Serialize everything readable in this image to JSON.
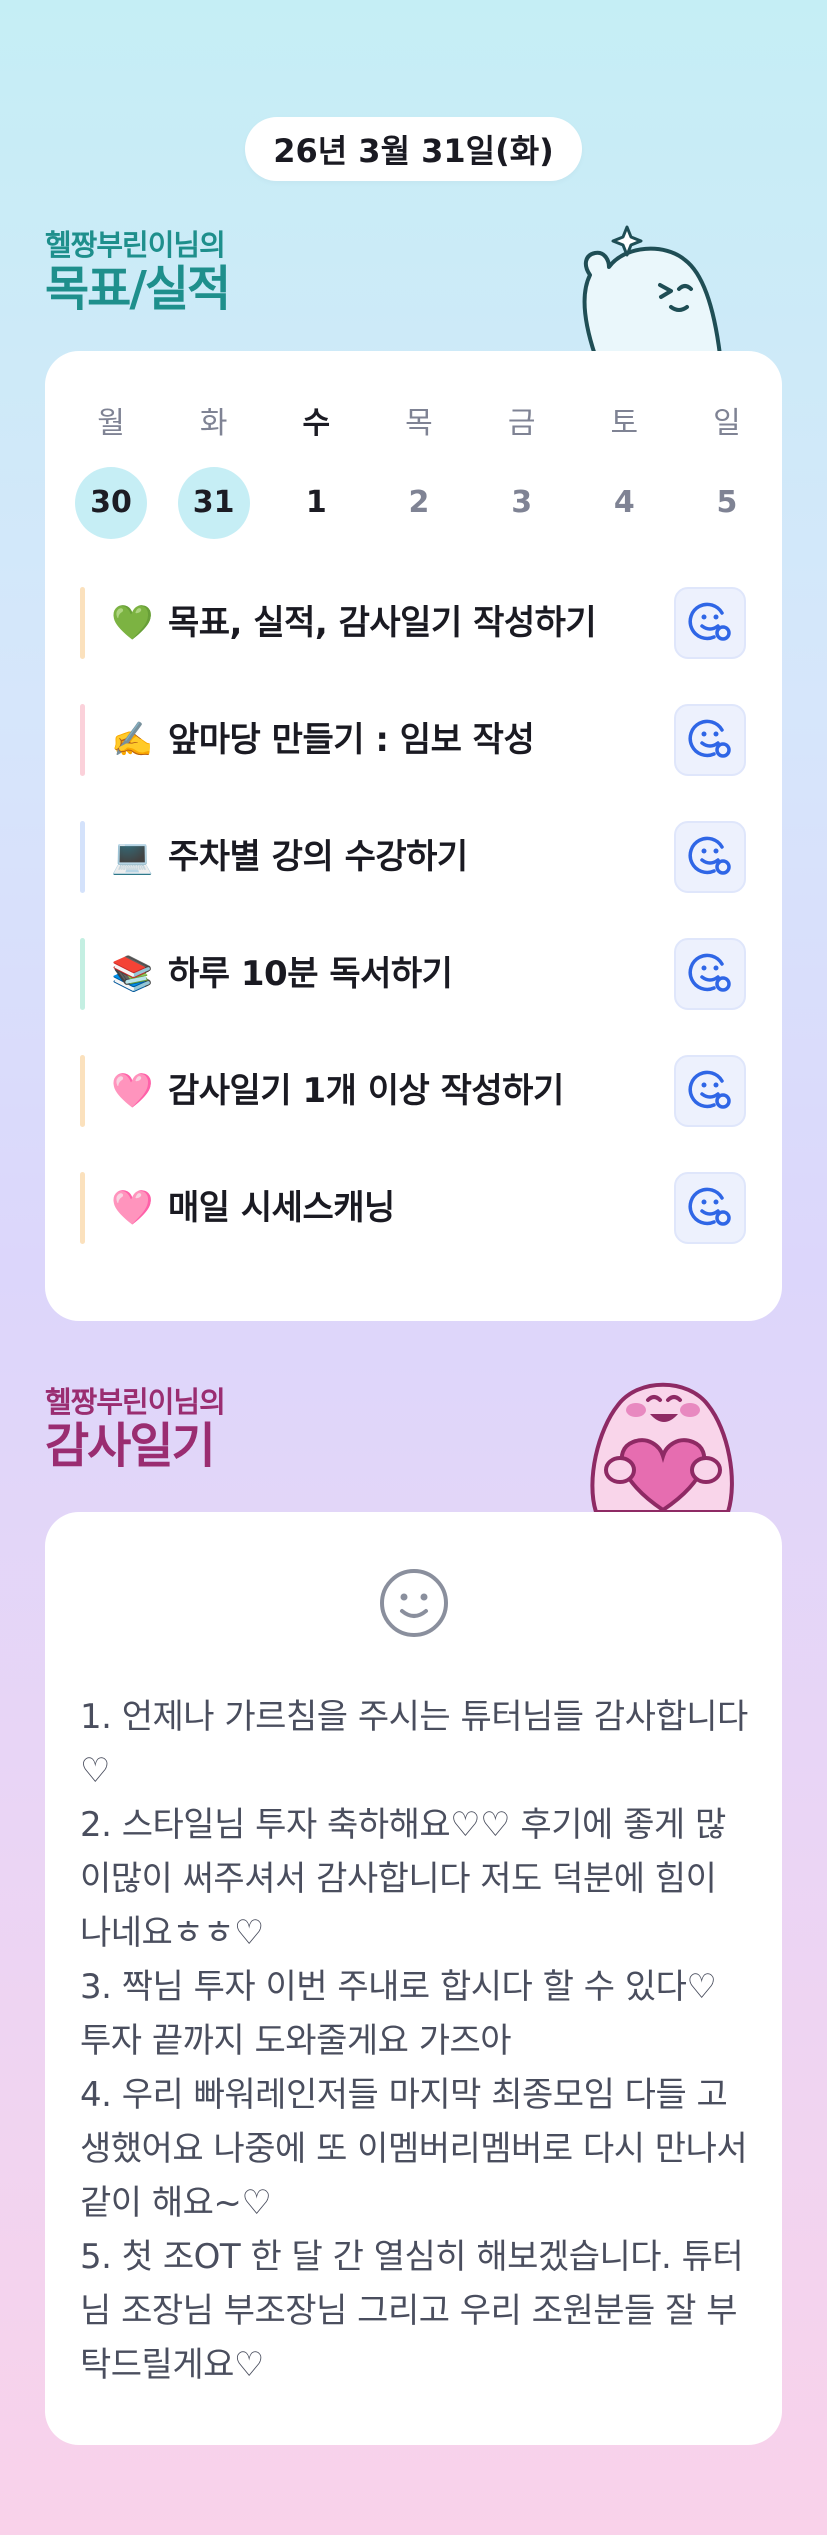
{
  "date": "26년 3월 31일(화)",
  "goals_section": {
    "subtitle": "헬짱부린이님의",
    "title": "목표/실적"
  },
  "week": {
    "days": [
      {
        "label": "월",
        "date": "30",
        "state": "done"
      },
      {
        "label": "화",
        "date": "31",
        "state": "done"
      },
      {
        "label": "수",
        "date": "1",
        "state": "today"
      },
      {
        "label": "목",
        "date": "2",
        "state": "future"
      },
      {
        "label": "금",
        "date": "3",
        "state": "future"
      },
      {
        "label": "토",
        "date": "4",
        "state": "future"
      },
      {
        "label": "일",
        "date": "5",
        "state": "future"
      }
    ]
  },
  "goals": [
    {
      "emoji": "💚",
      "text": "목표, 실적, 감사일기 작성하기",
      "bar_color": "#fbe1bd",
      "icon": "smile-plus-icon"
    },
    {
      "emoji": "✍️",
      "text": "앞마당 만들기 : 임보 작성",
      "bar_color": "#fbd1da",
      "icon": "smile-plus-icon"
    },
    {
      "emoji": "💻",
      "text": "주차별 강의 수강하기",
      "bar_color": "#d4e2fb",
      "icon": "smile-plus-icon"
    },
    {
      "emoji": "📚",
      "text": "하루 10분 독서하기",
      "bar_color": "#c4efe2",
      "icon": "smile-plus-icon"
    },
    {
      "emoji": "🩷",
      "text": "감사일기 1개 이상 작성하기",
      "bar_color": "#fbe1bd",
      "icon": "smile-plus-icon"
    },
    {
      "emoji": "🩷",
      "text": "매일 시세스캐닝",
      "bar_color": "#fbe1bd",
      "icon": "smile-plus-icon"
    }
  ],
  "gratitude_section": {
    "subtitle": "헬짱부린이님의",
    "title": "감사일기",
    "icon": "smile-icon",
    "lines": [
      "1. 언제나 가르침을 주시는 튜터님들 감사합니다♡",
      "2. 스타일님 투자 축하해요♡♡ 후기에 좋게 많이많이 써주셔서 감사합니다 저도 덕분에 힘이 나네요ㅎㅎ♡",
      "3. 짝님 투자 이번 주내로 합시다 할 수 있다♡ 투자 끝까지 도와줄게요 가즈아",
      "4. 우리 빠워레인저들 마지막 최종모임 다들 고생했어요 나중에 또 이멤버리멤버로 다시 만나서 같이 해요~♡",
      "5. 첫 조OT 한 달 간 열심히 해보겠습니다. 튜터님 조장님 부조장님 그리고 우리 조원분들 잘 부탁드릴게요♡"
    ]
  },
  "colors": {
    "goals_heading": "#1e8f8c",
    "gratitude_heading": "#9a2d71",
    "done_circle": "#c6eef5",
    "icon_blue": "#2f66e6"
  }
}
